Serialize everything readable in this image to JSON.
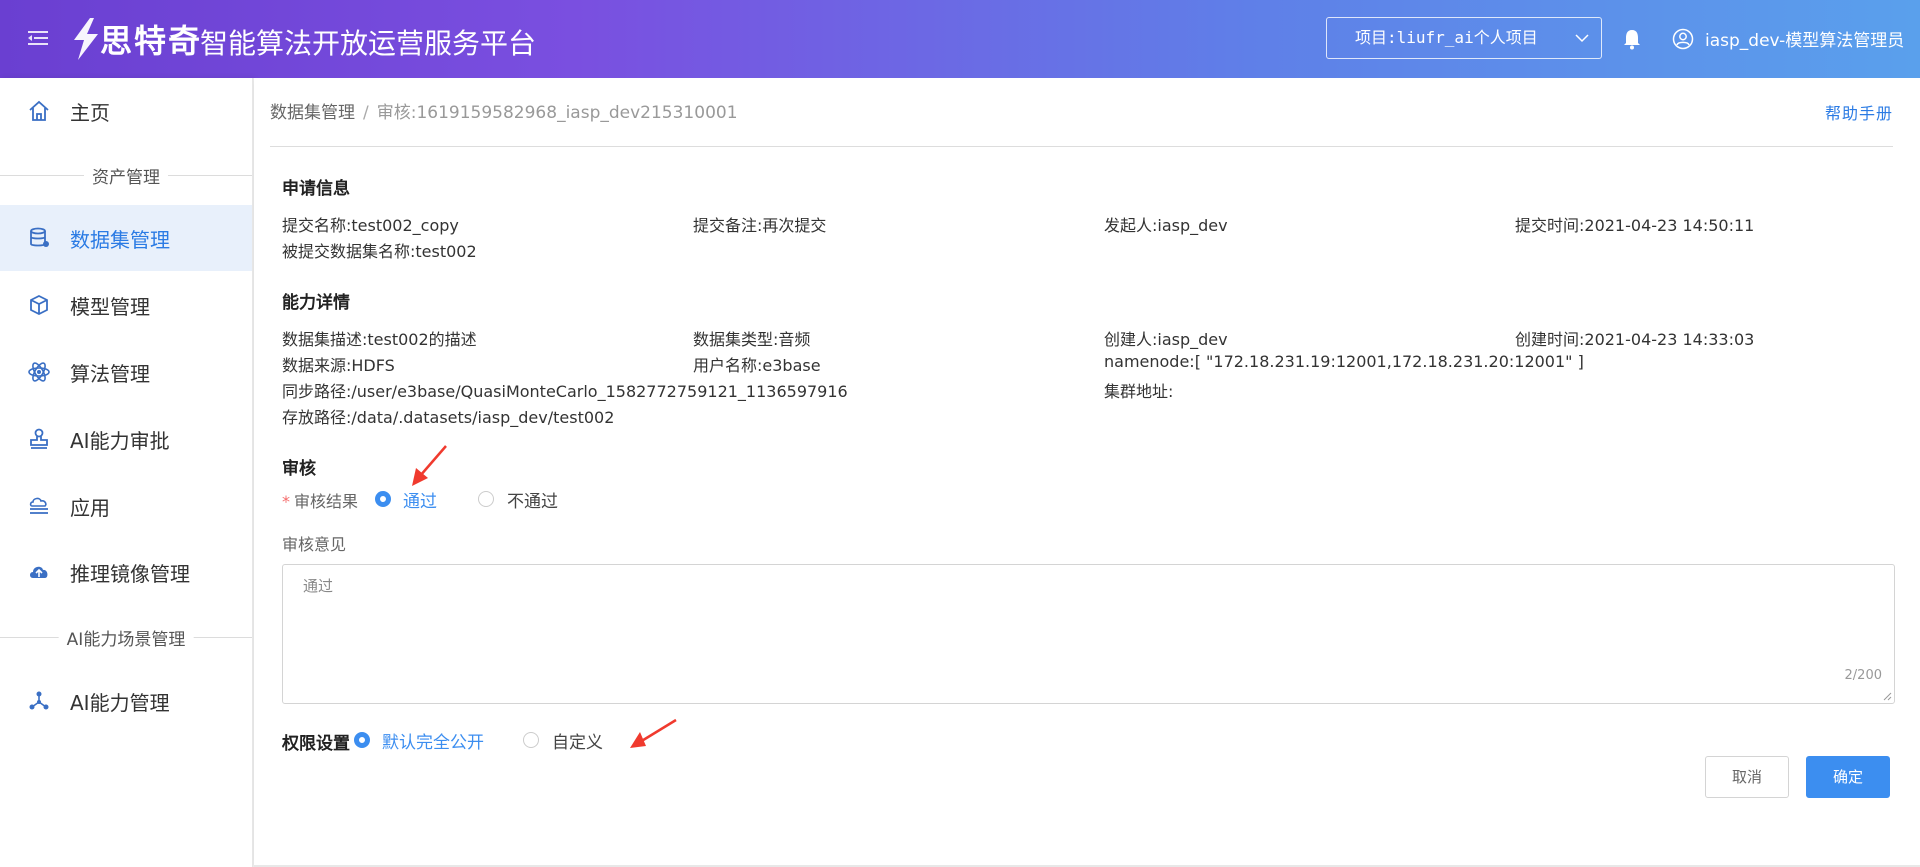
{
  "header": {
    "brand": "思特奇",
    "title": "智能算法开放运营服务平台",
    "project_select": "项目:liufr_ai个人项目",
    "user": "iasp_dev-模型算法管理员"
  },
  "sidebar": {
    "items": [
      {
        "label": "主页",
        "icon": "home-icon"
      },
      {
        "label": "数据集管理",
        "icon": "database-icon"
      },
      {
        "label": "模型管理",
        "icon": "cube-icon"
      },
      {
        "label": "算法管理",
        "icon": "atom-icon"
      },
      {
        "label": "AI能力审批",
        "icon": "stamp-icon"
      },
      {
        "label": "应用",
        "icon": "cloud-stack-icon"
      },
      {
        "label": "推理镜像管理",
        "icon": "cloud-upload-icon"
      },
      {
        "label": "AI能力管理",
        "icon": "network-icon"
      }
    ],
    "groups": [
      "资产管理",
      "AI能力场景管理"
    ]
  },
  "breadcrumb": {
    "parent": "数据集管理",
    "separator": "/",
    "current": "审核:1619159582968_iasp_dev215310001"
  },
  "help_link": "帮助手册",
  "apply_info": {
    "title": "申请信息",
    "submit_name": "提交名称:test002_copy",
    "submit_note": "提交备注:再次提交",
    "initiator": "发起人:iasp_dev",
    "submit_time": "提交时间:2021-04-23 14:50:11",
    "submitted_dataset": "被提交数据集名称:test002"
  },
  "capability": {
    "title": "能力详情",
    "desc": "数据集描述:test002的描述",
    "type": "数据集类型:音频",
    "creator": "创建人:iasp_dev",
    "create_time": "创建时间:2021-04-23 14:33:03",
    "source": "数据来源:HDFS",
    "username": "用户名称:e3base",
    "namenode": "namenode:[ \"172.18.231.19:12001,172.18.231.20:12001\" ]",
    "sync_path": "同步路径:/user/e3base/QuasiMonteCarlo_1582772759121_1136597916",
    "cluster": "集群地址:",
    "store_path": "存放路径:/data/.datasets/iasp_dev/test002"
  },
  "review": {
    "title": "审核",
    "result_label": "审核结果",
    "required_mark": "*",
    "pass": "通过",
    "fail": "不通过",
    "selected": "pass",
    "opinion_label": "审核意见",
    "opinion_value": "通过",
    "counter": "2/200"
  },
  "permission": {
    "title": "权限设置",
    "public": "默认完全公开",
    "custom": "自定义",
    "selected": "public"
  },
  "buttons": {
    "cancel": "取消",
    "confirm": "确定"
  },
  "colors": {
    "accent": "#3c8ef0",
    "header_start": "#6a3fd1",
    "header_end": "#5aa0ec",
    "arrow": "#f03a2e"
  }
}
